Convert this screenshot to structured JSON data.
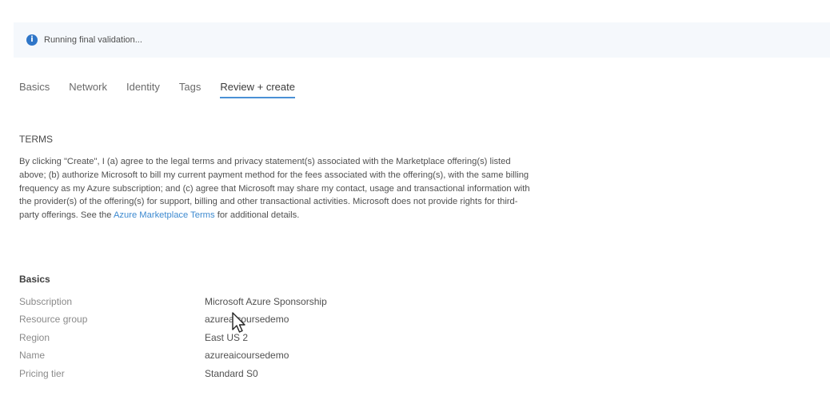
{
  "banner": {
    "icon": "info-icon",
    "text": "Running final validation..."
  },
  "tabs": [
    {
      "label": "Basics",
      "active": false
    },
    {
      "label": "Network",
      "active": false
    },
    {
      "label": "Identity",
      "active": false
    },
    {
      "label": "Tags",
      "active": false
    },
    {
      "label": "Review + create",
      "active": true
    }
  ],
  "terms": {
    "title": "TERMS",
    "text_before_link": "By clicking \"Create\", I (a) agree to the legal terms and privacy statement(s) associated with the Marketplace offering(s) listed above; (b) authorize Microsoft to bill my current payment method for the fees associated with the offering(s), with the same billing frequency as my Azure subscription; and (c) agree that Microsoft may share my contact, usage and transactional information with the provider(s) of the offering(s) for support, billing and other transactional activities. Microsoft does not provide rights for third-party offerings. See the ",
    "link_text": "Azure Marketplace Terms",
    "text_after_link": " for additional details."
  },
  "basics": {
    "title": "Basics",
    "rows": [
      {
        "label": "Subscription",
        "value": "Microsoft Azure Sponsorship"
      },
      {
        "label": "Resource group",
        "value": "azureaicoursedemo"
      },
      {
        "label": "Region",
        "value": "East US 2"
      },
      {
        "label": "Name",
        "value": "azureaicoursedemo"
      },
      {
        "label": "Pricing tier",
        "value": "Standard S0"
      }
    ]
  },
  "colors": {
    "accent": "#4a90d6",
    "link": "#3d8ad0",
    "info": "#2f76c8",
    "banner_bg": "#f5f8fc"
  }
}
